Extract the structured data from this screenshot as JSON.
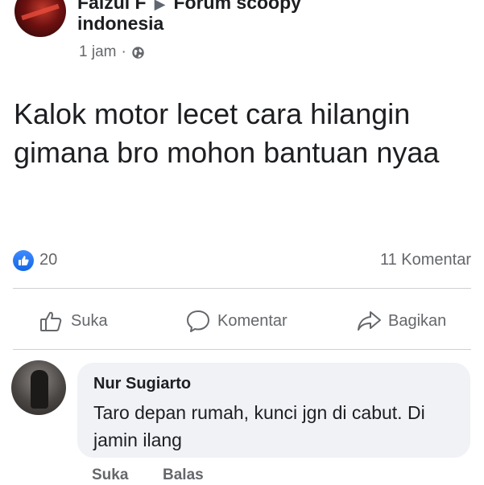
{
  "post": {
    "author": "Faizul F",
    "group": "Forum scoopy",
    "group_line2": "indonesia",
    "time": "1 jam",
    "dot": "·",
    "text": "Kalok motor lecet cara hilangin gimana bro mohon bantuan nyaa",
    "like_count": "20",
    "comment_count": "11 Komentar"
  },
  "actions": {
    "like": "Suka",
    "comment": "Komentar",
    "share": "Bagikan"
  },
  "comment": {
    "name": "Nur Sugiarto",
    "text": "Taro depan rumah, kunci jgn di cabut. Di jamin ilang",
    "like": "Suka",
    "reply": "Balas"
  },
  "colors": {
    "accent": "#1467e6",
    "muted": "#65676b",
    "bubble": "#f0f2f5"
  },
  "icons": [
    "globe-icon",
    "like-reaction-icon",
    "thumbs-up-icon",
    "comment-icon",
    "share-icon"
  ]
}
